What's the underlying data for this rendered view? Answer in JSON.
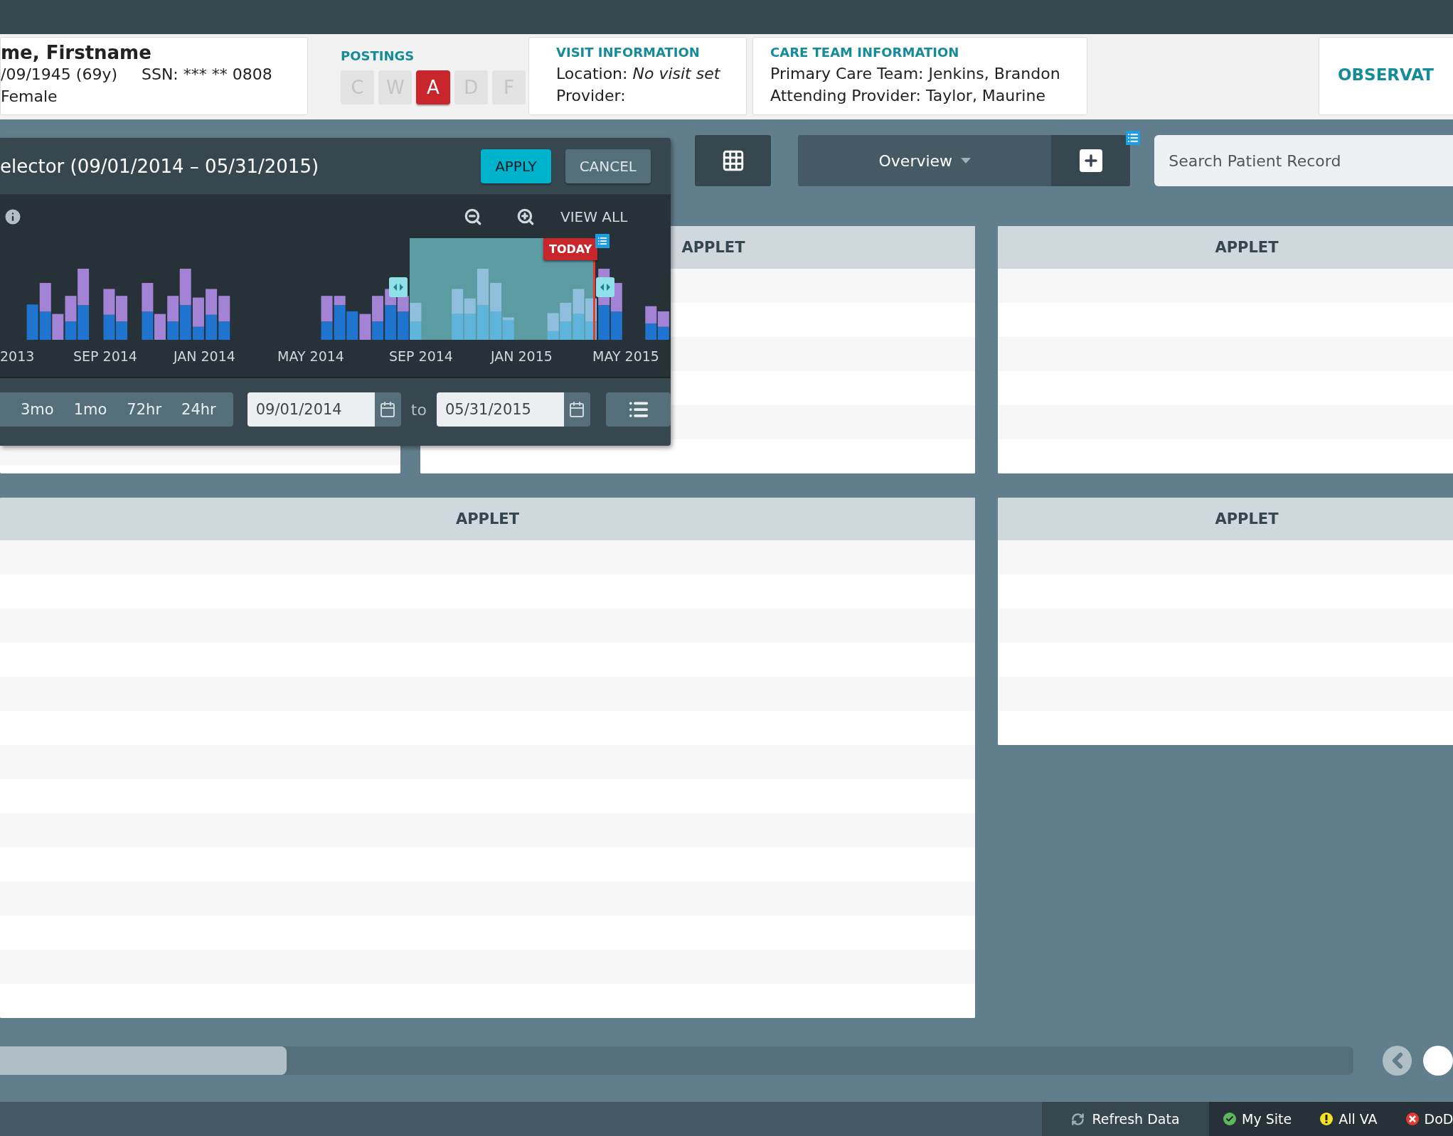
{
  "patient": {
    "name": "me, Firstname",
    "dob": "/09/1945 (69y)",
    "ssn": "SSN: *** ** 0808",
    "gender": "Female"
  },
  "postings": {
    "title": "POSTINGS",
    "items": [
      {
        "label": "C",
        "selected": false
      },
      {
        "label": "W",
        "selected": false
      },
      {
        "label": "A",
        "selected": true
      },
      {
        "label": "D",
        "selected": false
      },
      {
        "label": "F",
        "selected": false
      }
    ]
  },
  "visit": {
    "title": "VISIT INFORMATION",
    "lines": [
      "Location: *No visit set*",
      "Provider:"
    ]
  },
  "care_team": {
    "title": "CARE TEAM INFORMATION",
    "lines": [
      "Primary Care Team: Jenkins, Brandon",
      "Attending Provider: Taylor, Maurine"
    ]
  },
  "observation": {
    "title": "OBSERVAT"
  },
  "toolbar": {
    "workspace": "Overview",
    "search": {
      "placeholder": "Search Patient Record"
    }
  },
  "date_selector": {
    "title": "elector (09/01/2014 – 05/31/2015)",
    "apply": "APPLY",
    "cancel": "CANCEL",
    "view_all": "VIEW ALL",
    "today": "TODAY",
    "axis_labels": [
      "2013",
      "SEP 2014",
      "JAN 2014",
      "MAY 2014",
      "SEP 2014",
      "JAN 2015",
      "MAY 2015"
    ],
    "ranges": [
      "3mo",
      "1mo",
      "72hr",
      "24hr"
    ],
    "from": "09/01/2014",
    "to_label": "to",
    "to": "05/31/2015"
  },
  "applets": [
    {
      "title": "APPLET"
    },
    {
      "title": "APPLET"
    },
    {
      "title": "APPLET"
    },
    {
      "title": "APPLET"
    }
  ],
  "status_bar": {
    "refresh": "Refresh Data",
    "sites": [
      {
        "label": "My Site",
        "kind": "ok",
        "color": "#5cb85c"
      },
      {
        "label": "All VA",
        "kind": "warning",
        "color": "#f5e22a"
      },
      {
        "label": "DoD",
        "kind": "error",
        "color": "#e5392f"
      }
    ]
  }
}
